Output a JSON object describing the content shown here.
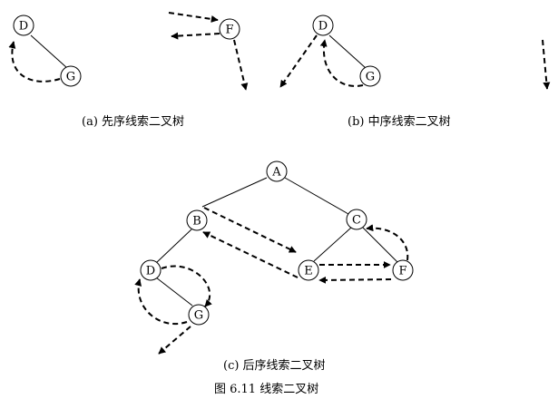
{
  "captions": {
    "a": "(a)  先序线索二叉树",
    "b": "(b)  中序线索二叉树",
    "c": "(c)  后序线索二叉树",
    "figure": "图 6.11    线索二叉树"
  },
  "nodes": {
    "a_D": "D",
    "a_G": "G",
    "a_F": "F",
    "b_D": "D",
    "b_G": "G",
    "c_A": "A",
    "c_B": "B",
    "c_C": "C",
    "c_D": "D",
    "c_E": "E",
    "c_F": "F",
    "c_G": "G"
  },
  "edges": [
    [
      "a_D",
      "a_G"
    ],
    [
      "b_D",
      "b_G"
    ],
    [
      "c_A",
      "c_B"
    ],
    [
      "c_A",
      "c_C"
    ],
    [
      "c_B",
      "c_D"
    ],
    [
      "c_D",
      "c_G"
    ],
    [
      "c_C",
      "c_E"
    ],
    [
      "c_C",
      "c_F"
    ]
  ],
  "threads": [
    [
      "a_G",
      "a_D"
    ],
    [
      "a_F",
      "a_F"
    ],
    [
      "b_D",
      "b_D"
    ],
    [
      "b_G",
      "b_D"
    ],
    [
      "c_B",
      "c_E"
    ],
    [
      "c_E",
      "c_B"
    ],
    [
      "c_E",
      "c_F"
    ],
    [
      "c_F",
      "c_E"
    ],
    [
      "c_F",
      "c_C"
    ],
    [
      "c_D",
      "c_G"
    ],
    [
      "c_G",
      "c_D"
    ]
  ],
  "colors": {
    "line": "#000000",
    "background": "#ffffff"
  }
}
